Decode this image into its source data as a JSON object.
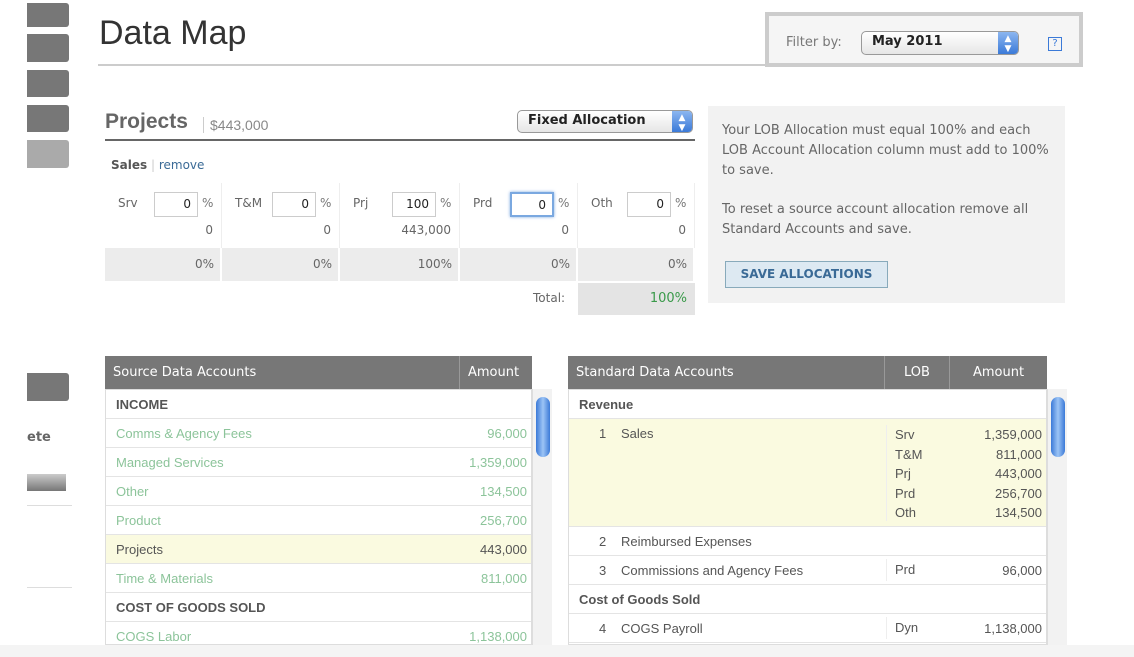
{
  "page_title": "Data Map",
  "filter": {
    "label": "Filter by:",
    "value": "May 2011",
    "help": "?"
  },
  "sidebar": {
    "partial_label": "ete"
  },
  "projects": {
    "title": "Projects",
    "amount": "$443,000",
    "allocation_type": "Fixed Allocation",
    "account": "Sales",
    "remove_link": "remove",
    "lobs": [
      {
        "code": "Srv",
        "pct": "0",
        "amount": "0",
        "share": "0%"
      },
      {
        "code": "T&M",
        "pct": "0",
        "amount": "0",
        "share": "0%"
      },
      {
        "code": "Prj",
        "pct": "100",
        "amount": "443,000",
        "share": "100%"
      },
      {
        "code": "Prd",
        "pct": "0",
        "amount": "0",
        "share": "0%"
      },
      {
        "code": "Oth",
        "pct": "0",
        "amount": "0",
        "share": "0%"
      }
    ],
    "pct_symbol": "%",
    "total_label": "Total:",
    "total_value": "100%"
  },
  "info": {
    "text1": "Your LOB Allocation must equal 100% and each LOB Account Allocation column must add to 100% to save.",
    "text2": "To reset a source account allocation remove all Standard Accounts and save.",
    "save_button": "SAVE ALLOCATIONS"
  },
  "source_table": {
    "headers": [
      "Source Data Accounts",
      "Amount"
    ],
    "rows": [
      {
        "name": "INCOME",
        "amount": "",
        "type": "group"
      },
      {
        "name": "Comms & Agency Fees",
        "amount": "96,000",
        "type": "mapped"
      },
      {
        "name": "Managed Services",
        "amount": "1,359,000",
        "type": "mapped"
      },
      {
        "name": "Other",
        "amount": "134,500",
        "type": "mapped"
      },
      {
        "name": "Product",
        "amount": "256,700",
        "type": "mapped"
      },
      {
        "name": "Projects",
        "amount": "443,000",
        "type": "selected"
      },
      {
        "name": "Time & Materials",
        "amount": "811,000",
        "type": "mapped"
      },
      {
        "name": "COST OF GOODS SOLD",
        "amount": "",
        "type": "group"
      },
      {
        "name": "COGS Labor",
        "amount": "1,138,000",
        "type": "mapped"
      }
    ]
  },
  "standard_table": {
    "headers": [
      "Standard Data Accounts",
      "LOB",
      "Amount"
    ],
    "groups": {
      "revenue": "Revenue",
      "cogs": "Cost of Goods Sold"
    },
    "sales": {
      "num": "1",
      "name": "Sales",
      "lobs": [
        "Srv",
        "T&M",
        "Prj",
        "Prd",
        "Oth"
      ],
      "amounts": [
        "1,359,000",
        "811,000",
        "443,000",
        "256,700",
        "134,500"
      ]
    },
    "rows": [
      {
        "num": "2",
        "name": "Reimbursed Expenses",
        "lob": "",
        "amount": ""
      },
      {
        "num": "3",
        "name": "Commissions and Agency Fees",
        "lob": "Prd",
        "amount": "96,000"
      },
      {
        "num": "4",
        "name": "COGS Payroll",
        "lob": "Dyn",
        "amount": "1,138,000"
      }
    ]
  },
  "colors": {
    "accent": "#3b7ad8",
    "mapped_text": "#8cc49a",
    "highlight": "#fafae0",
    "header_bg": "#777777"
  }
}
